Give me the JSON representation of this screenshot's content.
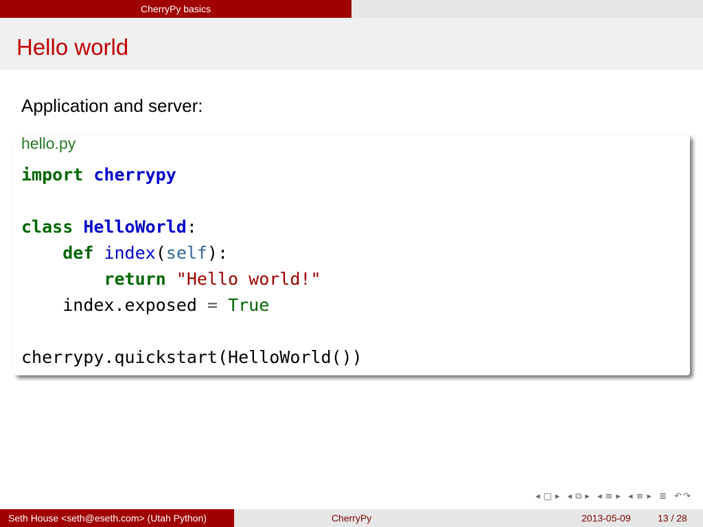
{
  "header": {
    "section": "CherryPy basics"
  },
  "frame": {
    "title": "Hello world"
  },
  "content": {
    "intro": "Application and server:",
    "file_label": "hello.py",
    "code": {
      "l1_kw": "import",
      "l1_mod": "cherrypy",
      "l3_kw": "class",
      "l3_name": "HelloWorld",
      "l3_colon": ":",
      "l4_kw": "def",
      "l4_fn": "index",
      "l4_open": "(",
      "l4_self": "self",
      "l4_close": "):",
      "l5_kw": "return",
      "l5_str": "\"Hello world!\"",
      "l6_lhs": "index.exposed",
      "l6_op": "=",
      "l6_val": "True",
      "l8": "cherrypy.quickstart(HelloWorld())"
    }
  },
  "nav_icons": [
    "nav-prev-frame-icon",
    "nav-frame-icon",
    "nav-next-frame-icon",
    "nav-prev-section-icon",
    "nav-section-icon",
    "nav-next-section-icon",
    "nav-prev-subsection-icon",
    "nav-subsection-icon",
    "nav-next-subsection-icon",
    "nav-align-icon",
    "nav-search-icon"
  ],
  "footer": {
    "author": "Seth House <seth@eseth.com>  (Utah Python)",
    "title": "CherryPy",
    "date": "2013-05-09",
    "page": "13 / 28"
  },
  "colors": {
    "accent": "#a00000",
    "title": "#c00000",
    "keyword": "#006600",
    "name": "#0000cc",
    "string": "#a00000"
  }
}
